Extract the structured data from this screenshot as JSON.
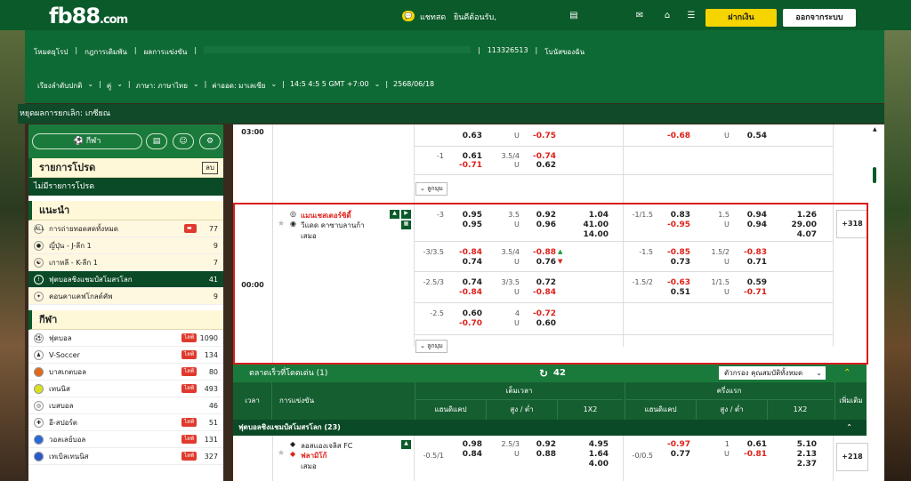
{
  "header": {
    "logo": "fb88",
    "logo_suffix": ".com",
    "chat": "แชทสด",
    "welcome": "ยินดีต้อนรับ,",
    "deposit": "ฝากเงิน",
    "logout": "ออกจากระบบ"
  },
  "nav": {
    "links": [
      "โหมดยุโรป",
      "กฎการเดิมพัน",
      "ผลการแข่งขัน"
    ],
    "ref": "113326513",
    "bonus": "โบนัสของฉัน",
    "sort": "เรียงลำดับปกติ",
    "pair": "คู่",
    "lang": "ภาษา: ภาษาไทย",
    "odds": "ค่าออด: มาเลเซีย",
    "time": "14:5 4:5 5 GMT +7:00",
    "date": "2568/06/18"
  },
  "strip": "หยุดผลการยกเลิก: เกซียณ",
  "sidebar": {
    "sport_btn": "กีฬา",
    "fav_title": "รายการโปรด",
    "fav_del": "ลบ",
    "fav_empty": "ไม่มีรายการโปรด",
    "rec_title": "แนะนำ",
    "rec": [
      {
        "label": "การถ่ายทอดสดทั้งหมด",
        "count": "77"
      },
      {
        "label": "ญี่ปุ่น - J-ลีก 1",
        "count": "9"
      },
      {
        "label": "เกาหลี - K-ลีก 1",
        "count": "7"
      },
      {
        "label": "ฟุตบอลชิงแชมป์สโมสรโลก",
        "count": "41"
      },
      {
        "label": "คอนคาแคฟโกลด์คัพ",
        "count": "9"
      }
    ],
    "sports_title": "กีฬา",
    "live": "ไลฟ์",
    "sports": [
      {
        "label": "ฟุตบอล",
        "count": "1090"
      },
      {
        "label": "V-Soccer",
        "count": "134"
      },
      {
        "label": "บาสเกตบอล",
        "count": "80"
      },
      {
        "label": "เทนนิส",
        "count": "493"
      },
      {
        "label": "เบสบอล",
        "count": "46"
      },
      {
        "label": "อี-สปอร์ต",
        "count": "51"
      },
      {
        "label": "วอลเลย์บอล",
        "count": "131"
      },
      {
        "label": "เทเบิลเทนนิส",
        "count": "327"
      }
    ]
  },
  "match1": {
    "time": "03:00",
    "rows": [
      {
        "hc": "",
        "h": "0.63",
        "a": "",
        "ou": "U",
        "o1": "",
        "o2": "-0.75",
        "hc2": "",
        "h2": "-0.68",
        "u2": "U",
        "o3": "0.54"
      },
      {
        "hc": "-1",
        "h": "0.61",
        "a": "-0.71",
        "ouv": "3.5/4",
        "ou": "U",
        "o1": "-0.74",
        "o2": "0.62"
      }
    ],
    "expand": "ลูกมุม"
  },
  "match2": {
    "time": "00:00",
    "home": "แมนเชสเตอร์ซิตี้",
    "away": "วีแดด คาซาบลานก้า",
    "draw": "เสมอ",
    "more": "+318",
    "expand": "ลูกมุม",
    "r1": {
      "hc": "-3",
      "h": "0.95",
      "a": "0.95",
      "ouv": "3.5",
      "u": "U",
      "o1": "0.92",
      "o2": "0.96",
      "x1": "1.04",
      "x2": "41.00",
      "x3": "14.00",
      "hc2": "-1/1.5",
      "h2": "0.83",
      "a2": "-0.95",
      "ouv2": "1.5",
      "u2": "U",
      "o3": "0.94",
      "o4": "0.94",
      "y1": "1.26",
      "y2": "29.00",
      "y3": "4.07"
    },
    "r2": {
      "hc": "-3/3.5",
      "h": "-0.84",
      "a": "0.74",
      "ouv": "3.5/4",
      "u": "U",
      "o1": "-0.88",
      "o2": "0.76",
      "hc2": "-1.5",
      "h2": "-0.85",
      "a2": "0.73",
      "ouv2": "1.5/2",
      "u2": "U",
      "o3": "-0.83",
      "o4": "0.71"
    },
    "r3": {
      "hc": "-2.5/3",
      "h": "0.74",
      "a": "-0.84",
      "ouv": "3/3.5",
      "u": "U",
      "o1": "0.72",
      "o2": "-0.84",
      "hc2": "-1.5/2",
      "h2": "-0.63",
      "a2": "0.51",
      "ouv2": "1/1.5",
      "u2": "U",
      "o3": "0.59",
      "o4": "-0.71"
    },
    "r4": {
      "hc": "-2.5",
      "h": "0.60",
      "a": "-0.70",
      "ouv": "4",
      "u": "U",
      "o1": "-0.72",
      "o2": "0.60"
    }
  },
  "bar": {
    "label": "ตลาดเร็วที่โดดเด่น (1)",
    "refresh": "42",
    "filter": "ตัวกรอง คุณสมบัติทั้งหมด"
  },
  "thead": {
    "time": "เวลา",
    "event": "การแข่งขัน",
    "full": "เต็มเวลา",
    "half": "ครึ่งแรก",
    "hc": "แฮนดิแคป",
    "ou": "สูง / ต่ำ",
    "x12": "1X2",
    "more": "เพิ่มเติม"
  },
  "league": "ฟุตบอลชิงแชมป์สโมสรโลก (23)",
  "match3": {
    "home": "ลอสแองเจลิส FC",
    "away": "ฟลามิโก้",
    "draw": "เสมอ",
    "hc": "-0.5/1",
    "h": "0.98",
    "a": "0.84",
    "ouv": "2.5/3",
    "u": "U",
    "o1": "0.92",
    "o2": "0.88",
    "x1": "4.95",
    "x2": "1.64",
    "x3": "4.00",
    "hc2": "-0/0.5",
    "h2": "-0.97",
    "a2": "0.77",
    "ouv2": "1",
    "u2": "U",
    "o3": "0.61",
    "o4": "-0.81",
    "y1": "5.10",
    "y2": "2.13",
    "y3": "2.37",
    "more": "+218"
  }
}
